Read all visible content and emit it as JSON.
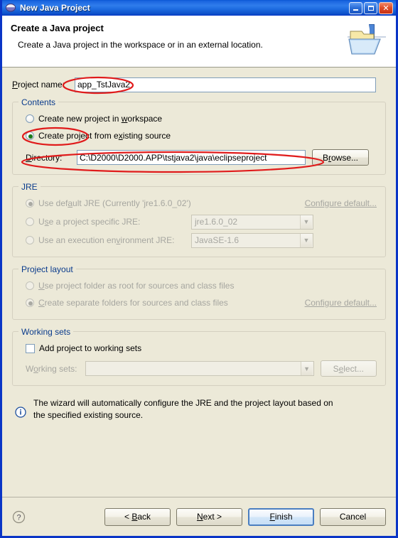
{
  "window": {
    "title": "New Java Project",
    "icon": "eclipse-globe-icon",
    "minimize_label": "Minimize",
    "maximize_label": "Maximize",
    "close_label": "Close",
    "titlebar_color": "#0a55d4",
    "body_color": "#ece9d8"
  },
  "header": {
    "title": "Create a Java project",
    "subtitle": "Create a Java project in the workspace or in an external location.",
    "icon": "java-project-folder-icon"
  },
  "project_name": {
    "label": "Project name:",
    "label_mnemonic": "P",
    "value": "app_TstJava2",
    "placeholder": ""
  },
  "contents": {
    "title": "Contents",
    "options": [
      {
        "label": "Create new project in workspace",
        "mnemonic": "w",
        "selected": false,
        "enabled": true
      },
      {
        "label": "Create project from existing source",
        "mnemonic": "x",
        "selected": true,
        "enabled": true
      }
    ],
    "directory": {
      "label": "Directory:",
      "label_mnemonic": "D",
      "value": "C:\\D2000\\D2000.APP\\tstjava2\\java\\eclipseproject",
      "browse_label": "Browse...",
      "browse_mnemonic": "r"
    }
  },
  "jre": {
    "title": "JRE",
    "enabled": false,
    "options": [
      {
        "label": "Use default JRE (Currently 'jre1.6.0_02')",
        "selected": true,
        "link": "Configure default..."
      },
      {
        "label": "Use a project specific JRE:",
        "selected": false,
        "combo_value": "jre1.6.0_02"
      },
      {
        "label": "Use an execution environment JRE:",
        "selected": false,
        "combo_value": "JavaSE-1.6"
      }
    ]
  },
  "project_layout": {
    "title": "Project layout",
    "enabled": false,
    "options": [
      {
        "label": "Use project folder as root for sources and class files",
        "selected": false
      },
      {
        "label": "Create separate folders for sources and class files",
        "selected": true,
        "link": "Configure default..."
      }
    ]
  },
  "working_sets": {
    "title": "Working sets",
    "checkbox_label": "Add project to working sets",
    "checkbox_checked": false,
    "combo_label": "Working sets:",
    "combo_value": "",
    "select_label": "Select...",
    "enabled": false
  },
  "info": {
    "icon": "info-icon",
    "text": "The wizard will automatically configure the JRE and the project layout based on the specified existing source."
  },
  "footer": {
    "help_label": "?",
    "buttons": [
      {
        "label": "< Back",
        "mnemonic": "B",
        "enabled": true,
        "default": false
      },
      {
        "label": "Next >",
        "mnemonic": "N",
        "enabled": true,
        "default": false
      },
      {
        "label": "Finish",
        "mnemonic": "F",
        "enabled": true,
        "default": true
      },
      {
        "label": "Cancel",
        "mnemonic": "",
        "enabled": true,
        "default": false
      }
    ]
  },
  "annotations": {
    "color": "#e01b1b",
    "marks": [
      {
        "name": "project-name-highlight",
        "target": "project name value"
      },
      {
        "name": "existing-source-radio-highlight",
        "target": "Create project from existing source"
      },
      {
        "name": "directory-row-highlight",
        "target": "Directory field and label"
      }
    ]
  }
}
